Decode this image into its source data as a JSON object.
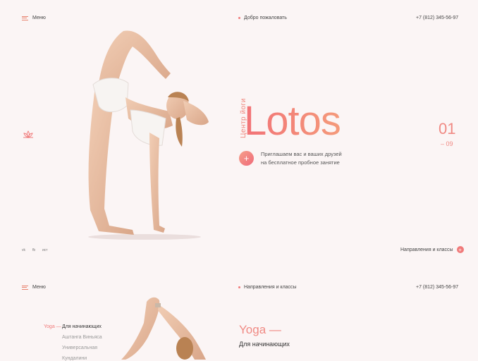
{
  "hero": {
    "menu_label": "Меню",
    "welcome": "Добро пожаловать",
    "phone": "+7 (812) 345-56-97",
    "brand_vertical": "Центр йоги",
    "title": "Lotos",
    "invite_line1": "Приглашаем вас и ваших друзей",
    "invite_line2": "на бесплатное пробное занятие",
    "plus": "+",
    "slide_current": "01",
    "slide_total": "– 09",
    "languages": [
      "vk",
      "fb",
      "ист"
    ],
    "directions_link": "Направления и классы"
  },
  "section2": {
    "menu_label": "Меню",
    "nav_title": "Направления и классы",
    "phone": "+7 (812) 345-56-97",
    "side_active_prefix": "Yoga —",
    "side_items": [
      "Для начинающих",
      "Аштанга Виньяса",
      "Универсальная",
      "Кундалини"
    ],
    "heading": "Yoga —",
    "subheading": "Для начинающих"
  },
  "colors": {
    "accent": "#f07a7a",
    "background": "#fbf5f5"
  }
}
